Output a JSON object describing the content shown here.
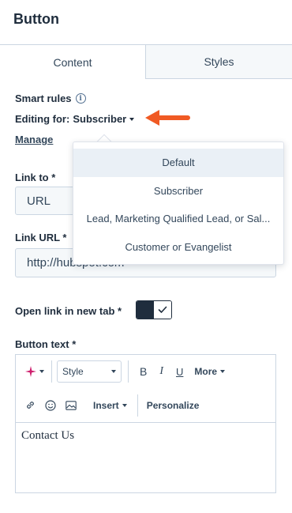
{
  "panel": {
    "title": "Button"
  },
  "tabs": [
    {
      "label": "Content",
      "active": true
    },
    {
      "label": "Styles",
      "active": false
    }
  ],
  "smart_rules": {
    "label": "Smart rules",
    "info_icon": "info-icon",
    "editing_for_label": "Editing for:",
    "editing_for_value": "Subscriber",
    "manage_label": "Manage"
  },
  "annotation": {
    "arrow_color": "#f05a24"
  },
  "dropdown": {
    "items": [
      {
        "label": "Default",
        "highlighted": true
      },
      {
        "label": "Subscriber",
        "highlighted": false
      },
      {
        "label": "Lead, Marketing Qualified Lead, or Sal...",
        "highlighted": false
      },
      {
        "label": "Customer or Evangelist",
        "highlighted": false
      }
    ]
  },
  "link_to": {
    "label": "Link to *",
    "value": "URL"
  },
  "link_url": {
    "label": "Link URL *",
    "value": "http://hubspot.com"
  },
  "open_new_tab": {
    "label": "Open link in new tab *",
    "enabled": true
  },
  "button_text": {
    "label": "Button text *",
    "toolbar": {
      "style_label": "Style",
      "bold_label": "B",
      "italic_label": "I",
      "underline_label": "U",
      "more_label": "More",
      "insert_label": "Insert",
      "personalize_label": "Personalize"
    },
    "content": "Contact Us"
  },
  "colors": {
    "text": "#33475b",
    "border": "#cbd6e2",
    "field_bg": "#f5f8fa",
    "highlight": "#eaf0f6",
    "ai_icon": "#ce1f6d",
    "annotation_arrow": "#f05a24"
  }
}
